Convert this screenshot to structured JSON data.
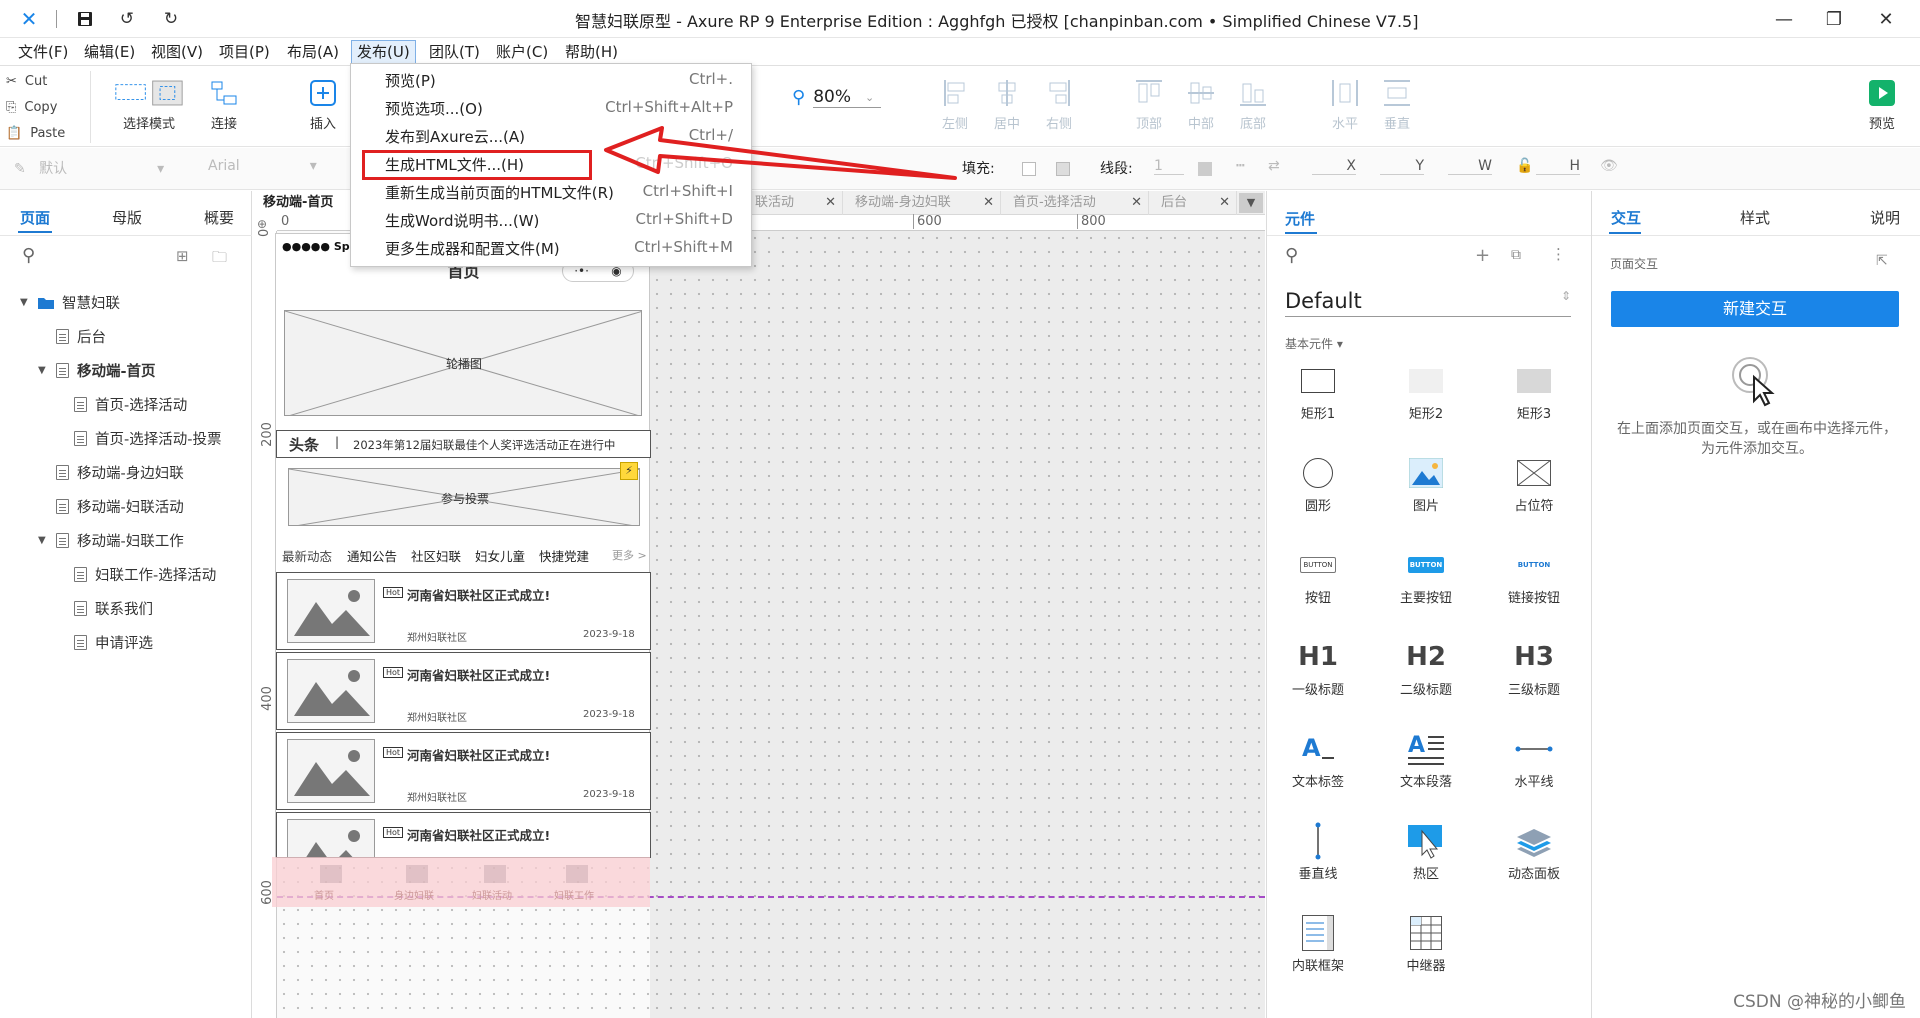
{
  "window": {
    "title": "智慧妇联原型 - Axure RP 9 Enterprise Edition : Agghfgh 已授权    [chanpinban.com • Simplified Chinese V7.5]"
  },
  "menubar": [
    "文件(F)",
    "编辑(E)",
    "视图(V)",
    "项目(P)",
    "布局(A)",
    "发布(U)",
    "团队(T)",
    "账户(C)",
    "帮助(H)"
  ],
  "toolbar": {
    "cut": "Cut",
    "copy": "Copy",
    "paste": "Paste",
    "select_mode": "选择模式",
    "connect": "连接",
    "insert": "插入",
    "zoom": "80%",
    "align": [
      "左侧",
      "居中",
      "右侧",
      "顶部",
      "中部",
      "底部",
      "水平",
      "垂直"
    ],
    "preview": "预览"
  },
  "format_bar": {
    "style": "默认",
    "font": "Arial",
    "fill_label": "填充:",
    "line_label": "线段:",
    "line_value": "1",
    "x": "X",
    "y": "Y",
    "w": "W",
    "h": "H"
  },
  "publish_menu": [
    {
      "label": "预览(P)",
      "shortcut": "Ctrl+."
    },
    {
      "label": "预览选项...(O)",
      "shortcut": "Ctrl+Shift+Alt+P"
    },
    {
      "label": "发布到Axure云...(A)",
      "shortcut": "Ctrl+/"
    },
    {
      "label": "生成HTML文件...(H)",
      "shortcut": "Ctrl+Shift+O"
    },
    {
      "label": "重新生成当前页面的HTML文件(R)",
      "shortcut": "Ctrl+Shift+I"
    },
    {
      "label": "生成Word说明书...(W)",
      "shortcut": "Ctrl+Shift+D"
    },
    {
      "label": "更多生成器和配置文件(M)",
      "shortcut": "Ctrl+Shift+M"
    }
  ],
  "left_panel": {
    "tabs": [
      "页面",
      "母版",
      "概要"
    ],
    "tree": [
      {
        "label": "智慧妇联",
        "level": 0,
        "type": "folder"
      },
      {
        "label": "后台",
        "level": 1,
        "type": "page"
      },
      {
        "label": "移动端-首页",
        "level": 1,
        "type": "page",
        "bold": true
      },
      {
        "label": "首页-选择活动",
        "level": 2,
        "type": "page"
      },
      {
        "label": "首页-选择活动-投票",
        "level": 2,
        "type": "page"
      },
      {
        "label": "移动端-身边妇联",
        "level": 1,
        "type": "page"
      },
      {
        "label": "移动端-妇联活动",
        "level": 1,
        "type": "page"
      },
      {
        "label": "移动端-妇联工作",
        "level": 1,
        "type": "page"
      },
      {
        "label": "妇联工作-选择活动",
        "level": 2,
        "type": "page"
      },
      {
        "label": "联系我们",
        "level": 2,
        "type": "page"
      },
      {
        "label": "申请评选",
        "level": 2,
        "type": "page"
      }
    ]
  },
  "canvas": {
    "tabs": [
      "移动端-首页",
      "联活动",
      "移动端-身边妇联",
      "首页-选择活动",
      "后台"
    ],
    "ruler_h": [
      "0",
      "600",
      "800"
    ],
    "ruler_v": [
      "0",
      "200",
      "400",
      "600"
    ],
    "phone": {
      "status": "●●●●● Sprin",
      "title": "首页",
      "banner": "轮播图",
      "headline_tag": "头条",
      "headline_text": "2023年第12届妇联最佳个人奖评选活动正在进行中",
      "vote": "参与投票",
      "nav": [
        "最新动态",
        "通知公告",
        "社区妇联",
        "妇女儿童",
        "快捷党建"
      ],
      "more": "更多 >",
      "news": [
        {
          "hot": "Hot",
          "title": "河南省妇联社区正式成立!",
          "source": "郑州妇联社区",
          "date": "2023-9-18"
        },
        {
          "hot": "Hot",
          "title": "河南省妇联社区正式成立!",
          "source": "郑州妇联社区",
          "date": "2023-9-18"
        },
        {
          "hot": "Hot",
          "title": "河南省妇联社区正式成立!",
          "source": "郑州妇联社区",
          "date": "2023-9-18"
        },
        {
          "hot": "Hot",
          "title": "河南省妇联社区正式成立!",
          "source": "",
          "date": ""
        }
      ],
      "bottom_nav": [
        "首页",
        "身边妇联",
        "妇联活动",
        "妇联工作"
      ]
    }
  },
  "library_panel": {
    "tab": "元件",
    "library_name": "Default",
    "section": "基本元件 ▾",
    "widgets": [
      "矩形1",
      "矩形2",
      "矩形3",
      "圆形",
      "图片",
      "占位符",
      "按钮",
      "主要按钮",
      "链接按钮",
      "一级标题",
      "二级标题",
      "三级标题",
      "文本标签",
      "文本段落",
      "水平线",
      "垂直线",
      "热区",
      "动态面板",
      "内联框架",
      "中继器"
    ],
    "widget_previews": [
      "BUTTON",
      "BUTTON",
      "BUTTON",
      "H1",
      "H2",
      "H3"
    ]
  },
  "interaction_panel": {
    "tabs": [
      "交互",
      "样式",
      "说明"
    ],
    "section": "页面交互",
    "new_button": "新建交互",
    "hint": "在上面添加页面交互，或在画布中选择元件，为元件添加交互。"
  },
  "watermark": "CSDN @神秘的小鲫鱼",
  "colors": {
    "accent": "#1e7ad2",
    "highlight_red": "#e02020",
    "primary_button": "#1a85e8"
  }
}
